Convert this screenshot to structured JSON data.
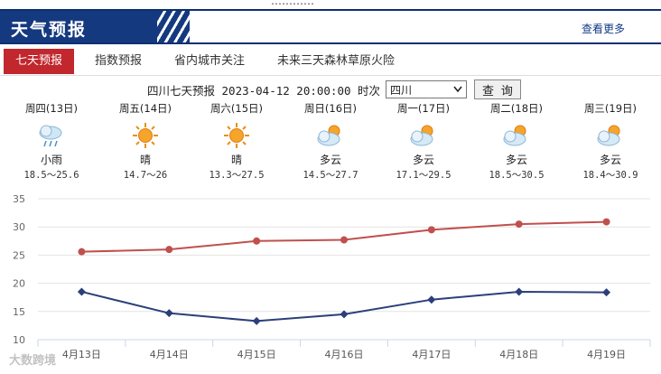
{
  "top_fragment": "…………",
  "header": {
    "title": "天气预报",
    "more_label": "查看更多"
  },
  "tabs": [
    {
      "label": "七天预报",
      "active": true
    },
    {
      "label": "指数预报",
      "active": false
    },
    {
      "label": "省内城市关注",
      "active": false
    },
    {
      "label": "未来三天森林草原火险",
      "active": false
    }
  ],
  "forecast_head": {
    "label": "四川七天预报 2023-04-12 20:00:00 时次",
    "selected_city": "四川",
    "query_label": "查 询"
  },
  "days": [
    {
      "name": "周四(13日)",
      "weather": "小雨",
      "icon": "rain-icon",
      "temp": "18.5～25.6"
    },
    {
      "name": "周五(14日)",
      "weather": "晴",
      "icon": "sun-icon",
      "temp": "14.7～26"
    },
    {
      "name": "周六(15日)",
      "weather": "晴",
      "icon": "sun-icon",
      "temp": "13.3～27.5"
    },
    {
      "name": "周日(16日)",
      "weather": "多云",
      "icon": "cloudy-icon",
      "temp": "14.5～27.7"
    },
    {
      "name": "周一(17日)",
      "weather": "多云",
      "icon": "cloudy-icon",
      "temp": "17.1～29.5"
    },
    {
      "name": "周二(18日)",
      "weather": "多云",
      "icon": "cloudy-icon",
      "temp": "18.5～30.5"
    },
    {
      "name": "周三(19日)",
      "weather": "多云",
      "icon": "cloudy-icon",
      "temp": "18.4～30.9"
    }
  ],
  "chart_data": {
    "type": "line",
    "categories": [
      "4月13日",
      "4月14日",
      "4月15日",
      "4月16日",
      "4月17日",
      "4月18日",
      "4月19日"
    ],
    "series": [
      {
        "values": [
          25.6,
          26,
          27.5,
          27.7,
          29.5,
          30.5,
          30.9
        ],
        "color": "#c0504d"
      },
      {
        "values": [
          18.5,
          14.7,
          13.3,
          14.5,
          17.1,
          18.5,
          18.4
        ],
        "color": "#2b3f7a"
      }
    ],
    "ylim": [
      10,
      35
    ],
    "yticks": [
      "10",
      "15",
      "20",
      "25",
      "30",
      "35"
    ],
    "grid": true
  },
  "watermark": "大数跨境",
  "colors": {
    "brand": "#15397f",
    "accent": "#c1272d"
  }
}
